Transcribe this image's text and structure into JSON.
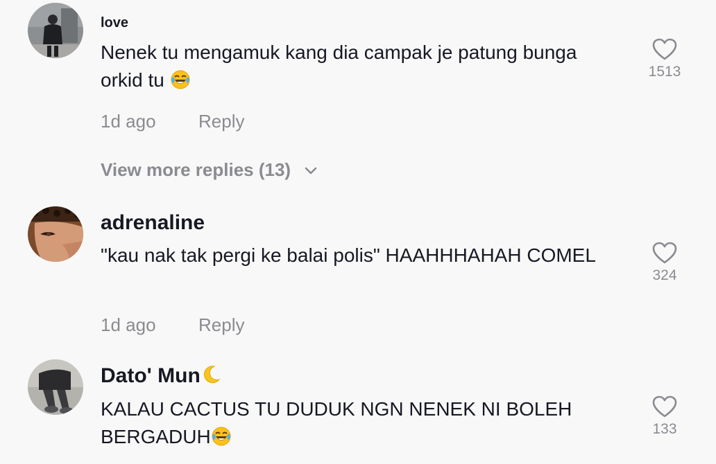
{
  "comments": [
    {
      "username": "love",
      "text": "Nenek tu mengamuk kang dia campak je patung bunga orkid tu",
      "emoji": "face-with-tears-of-joy",
      "time": "1d ago",
      "reply_label": "Reply",
      "likes": "1513",
      "view_more": "View more replies (13)"
    },
    {
      "username": "adrenaline",
      "text": "\"kau nak tak pergi ke balai polis\" HAAHHHAHAH COMEL",
      "time": "1d ago",
      "reply_label": "Reply",
      "likes": "324"
    },
    {
      "username": "Dato' Mun",
      "username_emoji": "crescent-moon",
      "text": "KALAU CACTUS TU DUDUK NGN NENEK NI BOLEH BERGADUH",
      "emoji": "face-with-tears-of-joy",
      "likes": "133"
    }
  ],
  "colors": {
    "background": "#f8f8f8",
    "primary_text": "#161823",
    "secondary_text": "#8a8b91"
  }
}
